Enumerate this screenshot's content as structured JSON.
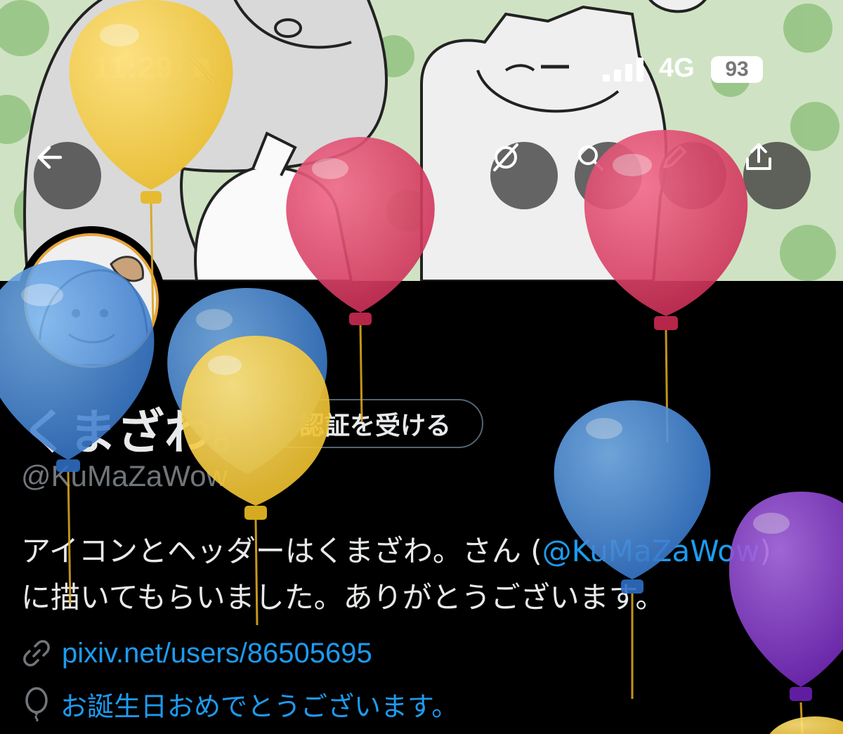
{
  "status_bar": {
    "time": "11:29",
    "network": "4G",
    "battery": "93"
  },
  "header_buttons": {
    "back_icon": "arrow-left-icon",
    "grok_icon": "slash-circle-icon",
    "search_icon": "search-icon",
    "edit_icon": "pencil-icon",
    "share_icon": "share-icon"
  },
  "profile": {
    "display_name": "くまざわ。",
    "verify_button": "認証を受ける",
    "handle": "@KuMaZaWow",
    "bio_part1": "アイコンとヘッダーはくまざわ。さん (",
    "bio_mention": "@KuMaZaWow",
    "bio_part2": ")",
    "bio_line2": "に描いてもらいました。ありがとうございます。",
    "link": "pixiv.net/users/86505695",
    "birthday": "お誕生日おめでとうございます。"
  },
  "colors": {
    "accent": "#1d9bf0",
    "background": "#000000",
    "balloon_yellow": "#f2c94c",
    "balloon_red": "#e0486a",
    "balloon_blue": "#4a8fdc",
    "balloon_purple": "#8b3fd1"
  }
}
